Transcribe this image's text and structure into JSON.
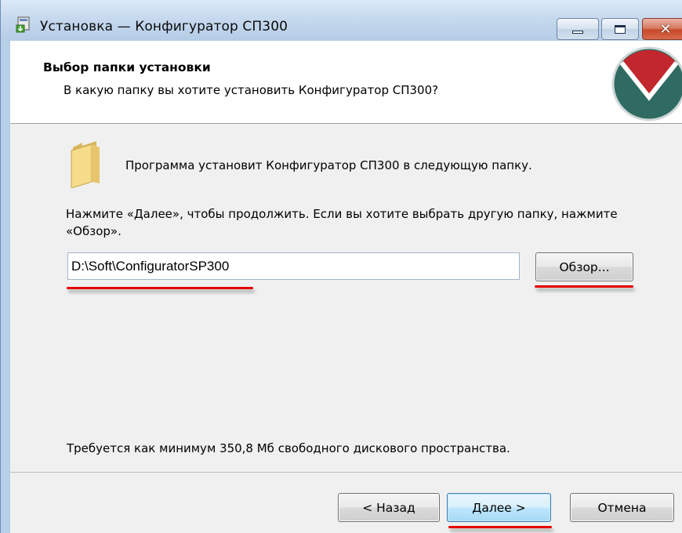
{
  "window": {
    "title": "Установка — Конфигуратор СП300",
    "icon": "installer-icon"
  },
  "header": {
    "title": "Выбор папки установки",
    "subtitle": "В какую папку вы хотите установить Конфигуратор СП300?",
    "logo": "company-logo"
  },
  "content": {
    "info": "Программа установит Конфигуратор СП300 в следующую папку.",
    "hint": "Нажмите «Далее», чтобы продолжить. Если вы хотите выбрать другую папку, нажмите «Обзор».",
    "path_value": "D:\\Soft\\ConfiguratorSP300",
    "browse_label": "Обзор...",
    "space_required": "Требуется как минимум 350,8 Мб свободного дискового пространства."
  },
  "footer": {
    "back_label": "< Назад",
    "next_label": "Далее >",
    "cancel_label": "Отмена"
  },
  "colors": {
    "annotation_red": "#e60000",
    "logo_red": "#c1272d",
    "logo_teal": "#2f6b63"
  }
}
